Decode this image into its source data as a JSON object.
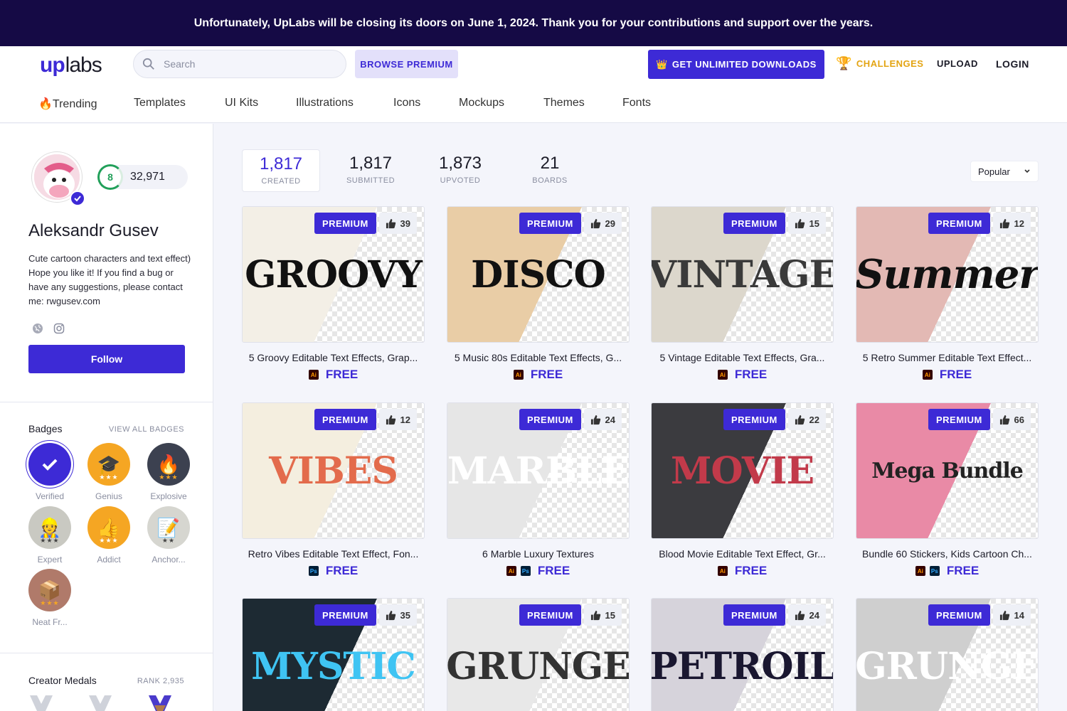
{
  "banner": {
    "text": "Unfortunately, UpLabs will be closing its doors on June 1, 2024. Thank you for your contributions and support over the years."
  },
  "header": {
    "logo_up": "up",
    "logo_labs": "labs",
    "search_placeholder": "Search",
    "browse_premium": "BROWSE PREMIUM",
    "unlimited": "GET UNLIMITED DOWNLOADS",
    "challenges": "CHALLENGES",
    "upload": "UPLOAD",
    "login": "LOGIN"
  },
  "categories": [
    "🔥Trending",
    "Templates",
    "UI Kits",
    "Illustrations",
    "Icons",
    "Mockups",
    "Themes",
    "Fonts"
  ],
  "profile": {
    "level": "8",
    "points": "32,971",
    "name": "Aleksandr Gusev",
    "bio": "Cute cartoon characters and text effect) Hope you like it! If you find a bug or have any suggestions, please contact me: rwgusev.com",
    "follow": "Follow"
  },
  "badges": {
    "title": "Badges",
    "link": "VIEW ALL BADGES",
    "items": [
      {
        "label": "Verified",
        "icon": "check-icon",
        "glyph": "✔",
        "color": "#3d2ad6"
      },
      {
        "label": "Genius",
        "icon": "graduation-cap-icon",
        "glyph": "🎓",
        "color": "#f5a623",
        "stars": "★★★"
      },
      {
        "label": "Explosive",
        "icon": "flame-icon",
        "glyph": "🔥",
        "color": "#3c4150",
        "stars": "★★★"
      },
      {
        "label": "Expert",
        "icon": "expert-icon",
        "glyph": "👷",
        "color": "#c9c9c2",
        "stars": "★★★"
      },
      {
        "label": "Addict",
        "icon": "thumbs-up-icon",
        "glyph": "👍",
        "color": "#f5a623",
        "stars": "★★★"
      },
      {
        "label": "Anchor...",
        "icon": "note-icon",
        "glyph": "📝",
        "color": "#d6d6d0",
        "stars": "★★"
      },
      {
        "label": "Neat Fr...",
        "icon": "box-icon",
        "glyph": "📦",
        "color": "#b07a6a",
        "stars": "★★★"
      }
    ]
  },
  "medals": {
    "title": "Creator Medals",
    "rank": "RANK 2,935"
  },
  "stats": [
    {
      "num": "1,817",
      "label": "CREATED"
    },
    {
      "num": "1,817",
      "label": "SUBMITTED"
    },
    {
      "num": "1,873",
      "label": "UPVOTED"
    },
    {
      "num": "21",
      "label": "BOARDS"
    }
  ],
  "sort": {
    "value": "Popular"
  },
  "premium_label": "PREMIUM",
  "free_label": "FREE",
  "cards": [
    {
      "title": "5 Groovy Editable Text Effects, Grap...",
      "likes": "39",
      "formats": [
        "Ai"
      ],
      "art": "GROOVY",
      "bg": "#f3efe6",
      "fg": "#111111"
    },
    {
      "title": "5 Music 80s Editable Text Effects, G...",
      "likes": "29",
      "formats": [
        "Ai"
      ],
      "art": "DISCO",
      "bg": "#e9cda6",
      "fg": "#111111"
    },
    {
      "title": "5 Vintage Editable Text Effects, Gra...",
      "likes": "15",
      "formats": [
        "Ai"
      ],
      "art": "VINTAGE",
      "bg": "#dcd7cc",
      "fg": "#3a3a3a"
    },
    {
      "title": "5 Retro Summer Editable Text Effect...",
      "likes": "12",
      "formats": [
        "Ai"
      ],
      "art": "Summer",
      "bg": "#e3b9b4",
      "fg": "#111111"
    },
    {
      "title": "Retro Vibes Editable Text Effect, Fon...",
      "likes": "12",
      "formats": [
        "Ps"
      ],
      "art": "VIBES",
      "bg": "#f4eedf",
      "fg": "#e36b4c"
    },
    {
      "title": "6 Marble Luxury Textures",
      "likes": "24",
      "formats": [
        "Ai",
        "Ps"
      ],
      "art": "MARBLE",
      "bg": "#e6e6e6",
      "fg": "#ffffff"
    },
    {
      "title": "Blood Movie Editable Text Effect, Gr...",
      "likes": "22",
      "formats": [
        "Ai"
      ],
      "art": "MOVIE",
      "bg": "#3b3b3f",
      "fg": "#c23a4a"
    },
    {
      "title": "Bundle 60 Stickers, Kids Cartoon Ch...",
      "likes": "66",
      "formats": [
        "Ai",
        "Ps"
      ],
      "art": "Mega Bundle",
      "bg": "#e98aa6",
      "fg": "#222222"
    },
    {
      "title": "",
      "likes": "35",
      "formats": [],
      "art": "MYSTIC",
      "bg": "#1d2a33",
      "fg": "#3fc4f3"
    },
    {
      "title": "",
      "likes": "15",
      "formats": [],
      "art": "GRUNGE",
      "bg": "#e8e8e8",
      "fg": "#333333"
    },
    {
      "title": "",
      "likes": "24",
      "formats": [],
      "art": "PETROIL",
      "bg": "#d6d3db",
      "fg": "#1a1730"
    },
    {
      "title": "",
      "likes": "14",
      "formats": [],
      "art": "GRUNGE",
      "bg": "#cfcfcf",
      "fg": "#ffffff"
    }
  ]
}
